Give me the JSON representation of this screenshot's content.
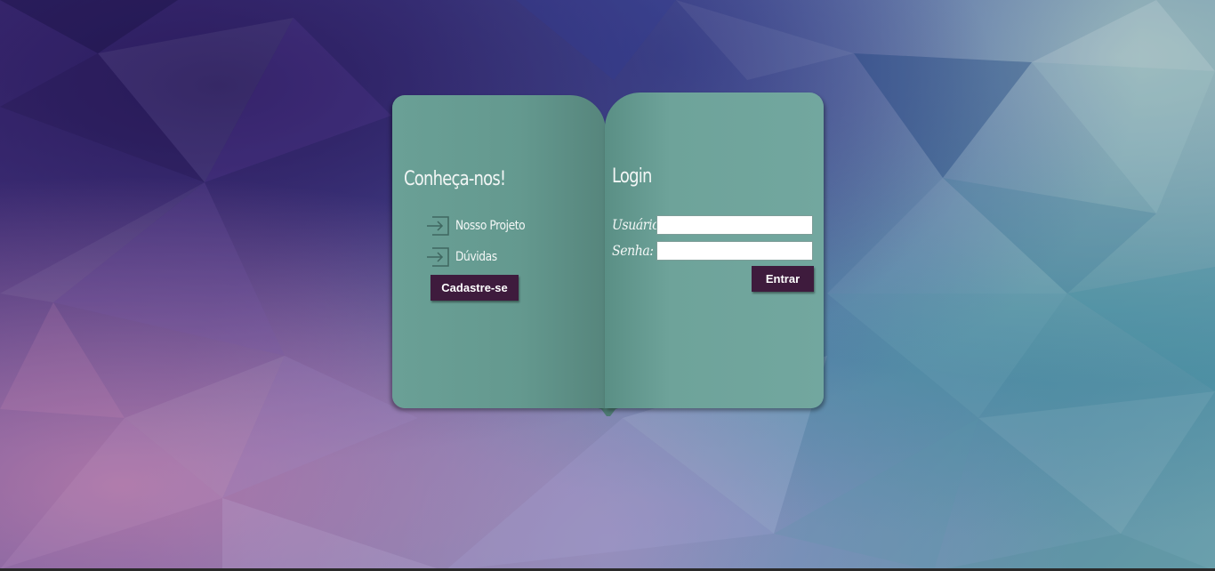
{
  "colors": {
    "page_teal": "#6ea39a",
    "button_bg": "#3e1b3d",
    "button_text": "#ffffff",
    "text_light": "#f3f7f6"
  },
  "left_page": {
    "title": "Conheça-nos!",
    "links": [
      {
        "label": "Nosso Projeto",
        "icon": "sign-in-arrow-icon"
      },
      {
        "label": "Dúvidas",
        "icon": "sign-in-arrow-icon"
      }
    ],
    "register_button": "Cadastre-se"
  },
  "right_page": {
    "title": "Login",
    "username": {
      "label": "Usuário:",
      "value": "",
      "placeholder": ""
    },
    "password": {
      "label": "Senha:",
      "value": "",
      "placeholder": ""
    },
    "submit_button": "Entrar"
  }
}
